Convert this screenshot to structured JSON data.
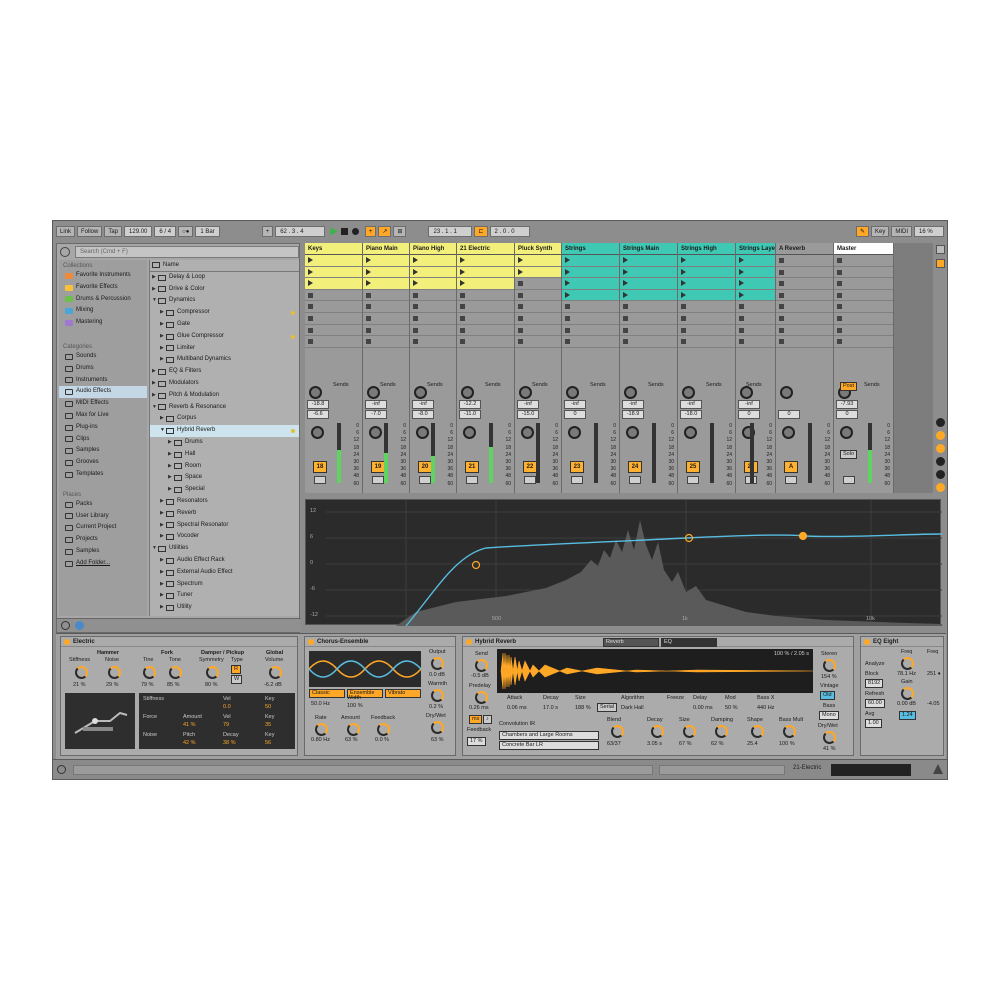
{
  "toolbar": {
    "link": "Link",
    "follow": "Follow",
    "tap": "Tap",
    "tempo": "129.00",
    "sig": "6 / 4",
    "quant": "1 Bar",
    "pos": "62 .  3 .  4",
    "loop_start": "23 .  1 .  1",
    "loop_len": "2 .  0 .  0",
    "key": "Key",
    "midi": "MIDI",
    "cpu": "16 %"
  },
  "browser": {
    "search_placeholder": "Search (Cmd + F)",
    "collections_label": "Collections",
    "collections": [
      {
        "label": "Favorite Instruments",
        "color": "#f08a3a"
      },
      {
        "label": "Favorite Effects",
        "color": "#f6c23e"
      },
      {
        "label": "Drums & Percussion",
        "color": "#6cc04a"
      },
      {
        "label": "Mixing",
        "color": "#4aa6d8"
      },
      {
        "label": "Mastering",
        "color": "#a078d0"
      }
    ],
    "categories_label": "Categories",
    "categories": [
      "Sounds",
      "Drums",
      "Instruments",
      "Audio Effects",
      "MIDI Effects",
      "Max for Live",
      "Plug-ins",
      "Clips",
      "Samples",
      "Grooves",
      "Templates"
    ],
    "places_label": "Places",
    "places": [
      "Packs",
      "User Library",
      "Current Project",
      "Projects",
      "Samples",
      "Add Folder..."
    ],
    "name_header": "Name",
    "files": [
      {
        "label": "Delay & Loop",
        "d": 0
      },
      {
        "label": "Drive & Color",
        "d": 0
      },
      {
        "label": "Dynamics",
        "d": 0,
        "open": true
      },
      {
        "label": "Compressor",
        "d": 1
      },
      {
        "label": "Gate",
        "d": 1
      },
      {
        "label": "Glue Compressor",
        "d": 1
      },
      {
        "label": "Limiter",
        "d": 1
      },
      {
        "label": "Multiband Dynamics",
        "d": 1
      },
      {
        "label": "EQ & Filters",
        "d": 0
      },
      {
        "label": "Modulators",
        "d": 0
      },
      {
        "label": "Pitch & Modulation",
        "d": 0
      },
      {
        "label": "Reverb & Resonance",
        "d": 0,
        "open": true
      },
      {
        "label": "Corpus",
        "d": 1
      },
      {
        "label": "Hybrid Reverb",
        "d": 1,
        "open": true,
        "sel": true
      },
      {
        "label": "Drums",
        "d": 2
      },
      {
        "label": "Hall",
        "d": 2
      },
      {
        "label": "Room",
        "d": 2
      },
      {
        "label": "Space",
        "d": 2
      },
      {
        "label": "Special",
        "d": 2
      },
      {
        "label": "Resonators",
        "d": 1
      },
      {
        "label": "Reverb",
        "d": 1
      },
      {
        "label": "Spectral Resonator",
        "d": 1
      },
      {
        "label": "Vocoder",
        "d": 1
      },
      {
        "label": "Utilities",
        "d": 0,
        "open": true
      },
      {
        "label": "Audio Effect Rack",
        "d": 1
      },
      {
        "label": "External Audio Effect",
        "d": 1
      },
      {
        "label": "Spectrum",
        "d": 1
      },
      {
        "label": "Tuner",
        "d": 1
      },
      {
        "label": "Utility",
        "d": 1
      }
    ]
  },
  "tracks": [
    {
      "name": "Keys",
      "color": "#f2ef7a",
      "num": "18",
      "vol": "-6.6",
      "send": "-18.8",
      "meter": 0.55
    },
    {
      "name": "Piano Main",
      "color": "#f2ef7a",
      "num": "19",
      "vol": "-7.0",
      "send": "-inf",
      "meter": 0.5
    },
    {
      "name": "Piano High",
      "color": "#f2ef7a",
      "num": "20",
      "vol": "-8.0",
      "send": "-inf",
      "meter": 0.45
    },
    {
      "name": "21 Electric",
      "color": "#f2ef7a",
      "num": "21",
      "vol": "-11.0",
      "send": "-12.2",
      "meter": 0.6
    },
    {
      "name": "Pluck Synth",
      "color": "#f2ef7a",
      "num": "22",
      "vol": "-15.0",
      "send": "-inf",
      "meter": 0.0
    },
    {
      "name": "Strings",
      "color": "#3fc9b4",
      "num": "23",
      "vol": "0",
      "send": "-inf",
      "meter": 0.0
    },
    {
      "name": "Strings Main",
      "color": "#3fc9b4",
      "num": "24",
      "vol": "-18.9",
      "send": "-inf",
      "meter": 0.0
    },
    {
      "name": "Strings High",
      "color": "#3fc9b4",
      "num": "25",
      "vol": "-18.0",
      "send": "-inf",
      "meter": 0.0
    },
    {
      "name": "Strings Layer",
      "color": "#3fc9b4",
      "num": "26",
      "vol": "0",
      "send": "-inf",
      "meter": 0.0
    },
    {
      "name": "A Reverb",
      "color": "#9a9a9a",
      "num": "A",
      "vol": "0",
      "send": "",
      "meter": 0.0
    },
    {
      "name": "Master",
      "color": "#ffffff",
      "num": "",
      "vol": "0",
      "send": "-7.93",
      "meter": 0.55
    }
  ],
  "mixer": {
    "sends_label": "Sends",
    "post_label": "Post",
    "solo_label": "Solo",
    "db_scale": [
      "0",
      "6",
      "12",
      "18",
      "24",
      "30",
      "36",
      "48",
      "60"
    ]
  },
  "eq_display": {
    "y_labels": [
      "12",
      "6",
      "0",
      "-6",
      "-12"
    ],
    "x_labels": [
      "500",
      "1k",
      "10k"
    ],
    "points": [
      "1",
      "3",
      "4"
    ]
  },
  "devices": {
    "electric": {
      "title": "Electric",
      "hammer": "Hammer",
      "stiffness": "Stiffness",
      "stiffness_val": "21 %",
      "noise": "Noise",
      "noise_val": "29 %",
      "fork": "Fork",
      "tine": "Tine",
      "tine_val": "79 %",
      "tone": "Tone",
      "tone_val": "85 %",
      "damper": "Damper / Pickup",
      "symmetry": "Symmetry",
      "symmetry_val": "80 %",
      "type": "Type",
      "type_r": "R",
      "type_w": "W",
      "global": "Global",
      "volume": "Volume",
      "volume_val": "-6.2 dB",
      "mod_rows": [
        {
          "name": "Stiffness",
          "a": "",
          "av": "",
          "b": "Vel",
          "bv": "0.0",
          "c": "Key",
          "cv": "50"
        },
        {
          "name": "Force",
          "a": "Amount",
          "av": "41 %",
          "b": "Vel",
          "bv": "79",
          "c": "Key",
          "cv": "35"
        },
        {
          "name": "Noise",
          "a": "Pitch",
          "av": "42 %",
          "b": "Decay",
          "bv": "38 %",
          "c": "Key",
          "cv": "56"
        }
      ]
    },
    "chorus": {
      "title": "Chorus-Ensemble",
      "output": "Output",
      "output_val": "0.0 dB",
      "warmth": "Warmth",
      "warmth_val": "0.2 %",
      "drywet": "Dry/Wet",
      "drywet_val": "63 %",
      "freq": "50.0 Hz",
      "width": "Width",
      "width_val": "100 %",
      "modes": [
        "Classic",
        "Ensemble",
        "Vibrato"
      ],
      "rate": "Rate",
      "rate_val": "0.80 Hz",
      "amount": "Amount",
      "amount_val": "63 %",
      "feedback": "Feedback",
      "feedback_val": "0.0 %"
    },
    "hybrid": {
      "title": "Hybrid Reverb",
      "tab_reverb": "Reverb",
      "tab_eq": "EQ",
      "send": "Send",
      "send_val": "-0.5 dB",
      "predelay": "Predelay",
      "predelay_val": "0.26 ms",
      "feedback": "Feedback",
      "feedback_val": "17 %",
      "ms": "ms",
      "ms2": "♪",
      "ir_info": "100 % / 2.05 s",
      "attack": "Attack",
      "attack_val": "0.06 ms",
      "decay": "Decay",
      "decay_val": "17.0 s",
      "size": "Size",
      "size_val": "188 %",
      "routing": "Serial",
      "algorithm": "Algorithm",
      "algorithm_val": "Dark Hall",
      "freeze": "Freeze",
      "delay": "Delay",
      "delay_val": "0.00 ms",
      "mod": "Mod",
      "mod_val": "50 %",
      "bassx": "Bass X",
      "bassx_val": "440 Hz",
      "conv": "Convolution IR",
      "ir1": "Chambers and Large Rooms",
      "ir2": "Concrete Bar LR",
      "blend": "Blend",
      "blend_val": "63/37",
      "decay2": "Decay",
      "decay2_val": "3.05 s",
      "size2": "Size",
      "size2_val": "67 %",
      "damping": "Damping",
      "damping_val": "62 %",
      "shape": "Shape",
      "shape_val": "25.4",
      "bassmult": "Bass Mult",
      "bassmult_val": "100 %",
      "stereo": "Stereo",
      "stereo_val": "154 %",
      "vintage": "Vintage",
      "vintage_val": "Old",
      "bass": "Bass",
      "bass_val": "Mono",
      "drywet": "Dry/Wet",
      "drywet_val": "41 %"
    },
    "eq8": {
      "title": "EQ Eight",
      "analyze": "Analyze",
      "block": "Block",
      "block_val": "8192",
      "refresh": "Refresh",
      "refresh_val": "60.00",
      "avg": "Avg",
      "avg_val": "1.00",
      "freq": "Freq",
      "freq_val": "78.1 Hz",
      "gain": "Gain",
      "gain_val": "0.00 dB",
      "q_val": "1.24",
      "freq2": "Freq",
      "freq2_val": "251 ♦",
      "gain2_val": "-4.05"
    }
  },
  "status": {
    "track": "21-Electric"
  }
}
